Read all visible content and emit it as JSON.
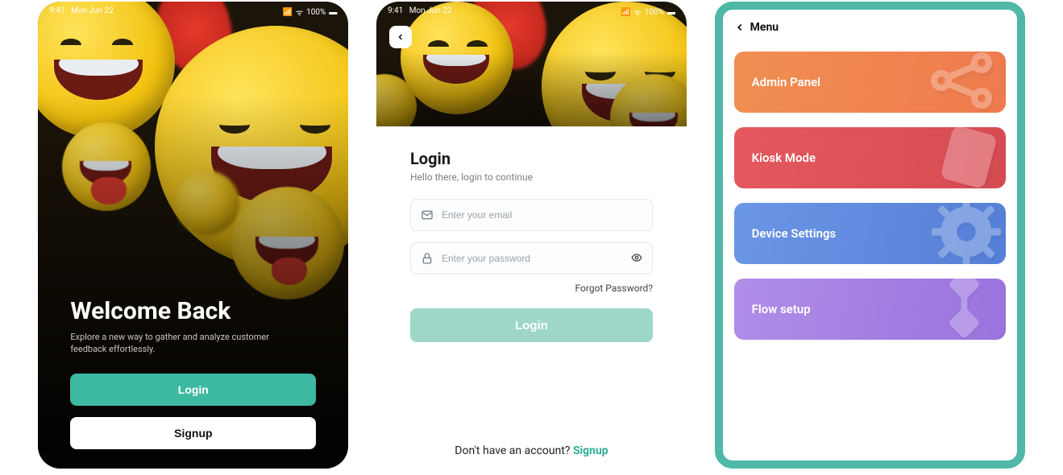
{
  "status_bar": {
    "time": "9:41",
    "date": "Mon Jun 22",
    "battery": "100%"
  },
  "screen1": {
    "title": "Welcome Back",
    "subtitle": "Explore a new way to gather and analyze customer feedback effortlessly.",
    "login_label": "Login",
    "signup_label": "Signup"
  },
  "screen2": {
    "heading": "Login",
    "subheading": "Hello there, login to continue",
    "email_placeholder": "Enter your email",
    "password_placeholder": "Enter your password",
    "forgot_label": "Forgot Password?",
    "submit_label": "Login",
    "signup_prompt": "Don't have an account? ",
    "signup_link": "Signup"
  },
  "screen3": {
    "menu_label": "Menu",
    "tiles": {
      "admin": "Admin Panel",
      "kiosk": "Kiosk Mode",
      "device": "Device Settings",
      "flow": "Flow setup"
    }
  }
}
